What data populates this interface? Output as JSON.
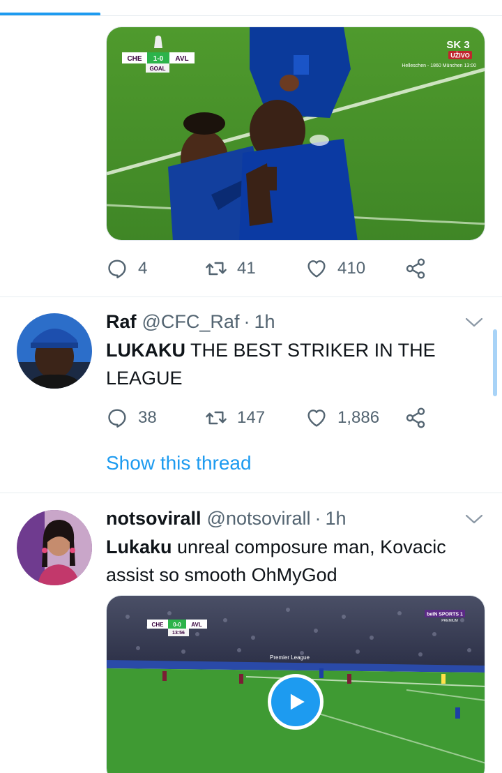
{
  "colors": {
    "accent": "#1d9bf0",
    "muted": "#536471",
    "text": "#0f1419"
  },
  "tweet_top": {
    "media": {
      "scoreboard": {
        "home": "CHE",
        "score": "1-0",
        "away": "AVL",
        "status": "GOAL"
      },
      "channel_logo": "SK 3",
      "channel_live": "UŽIVO",
      "ticker": "Helleschen - 1860 München 13:00"
    },
    "actions": {
      "replies": "4",
      "retweets": "41",
      "likes": "410"
    }
  },
  "tweet_raf": {
    "name": "Raf",
    "handle": "@CFC_Raf",
    "separator": "·",
    "time": "1h",
    "text_bold": "LUKAKU",
    "text_rest": " THE BEST STRIKER IN THE LEAGUE",
    "actions": {
      "replies": "38",
      "retweets": "147",
      "likes": "1,886"
    },
    "show_thread": "Show this thread"
  },
  "tweet_notso": {
    "name": "notsovirall",
    "handle": "@notsovirall",
    "separator": "·",
    "time": "1h",
    "text_bold": "Lukaku",
    "text_rest": " unreal composure man, Kovacic assist so smooth OhMyGod",
    "media": {
      "scoreboard": {
        "home": "CHE",
        "score": "0-0",
        "away": "AVL",
        "clock": "13:56"
      },
      "channel_logo": "beIN SPORTS 1",
      "channel_sub": "PREMIUM",
      "ad_board": "Premier League"
    }
  },
  "icons": [
    "reply-icon",
    "retweet-icon",
    "like-icon",
    "share-icon",
    "chevron-down-icon",
    "play-icon"
  ]
}
